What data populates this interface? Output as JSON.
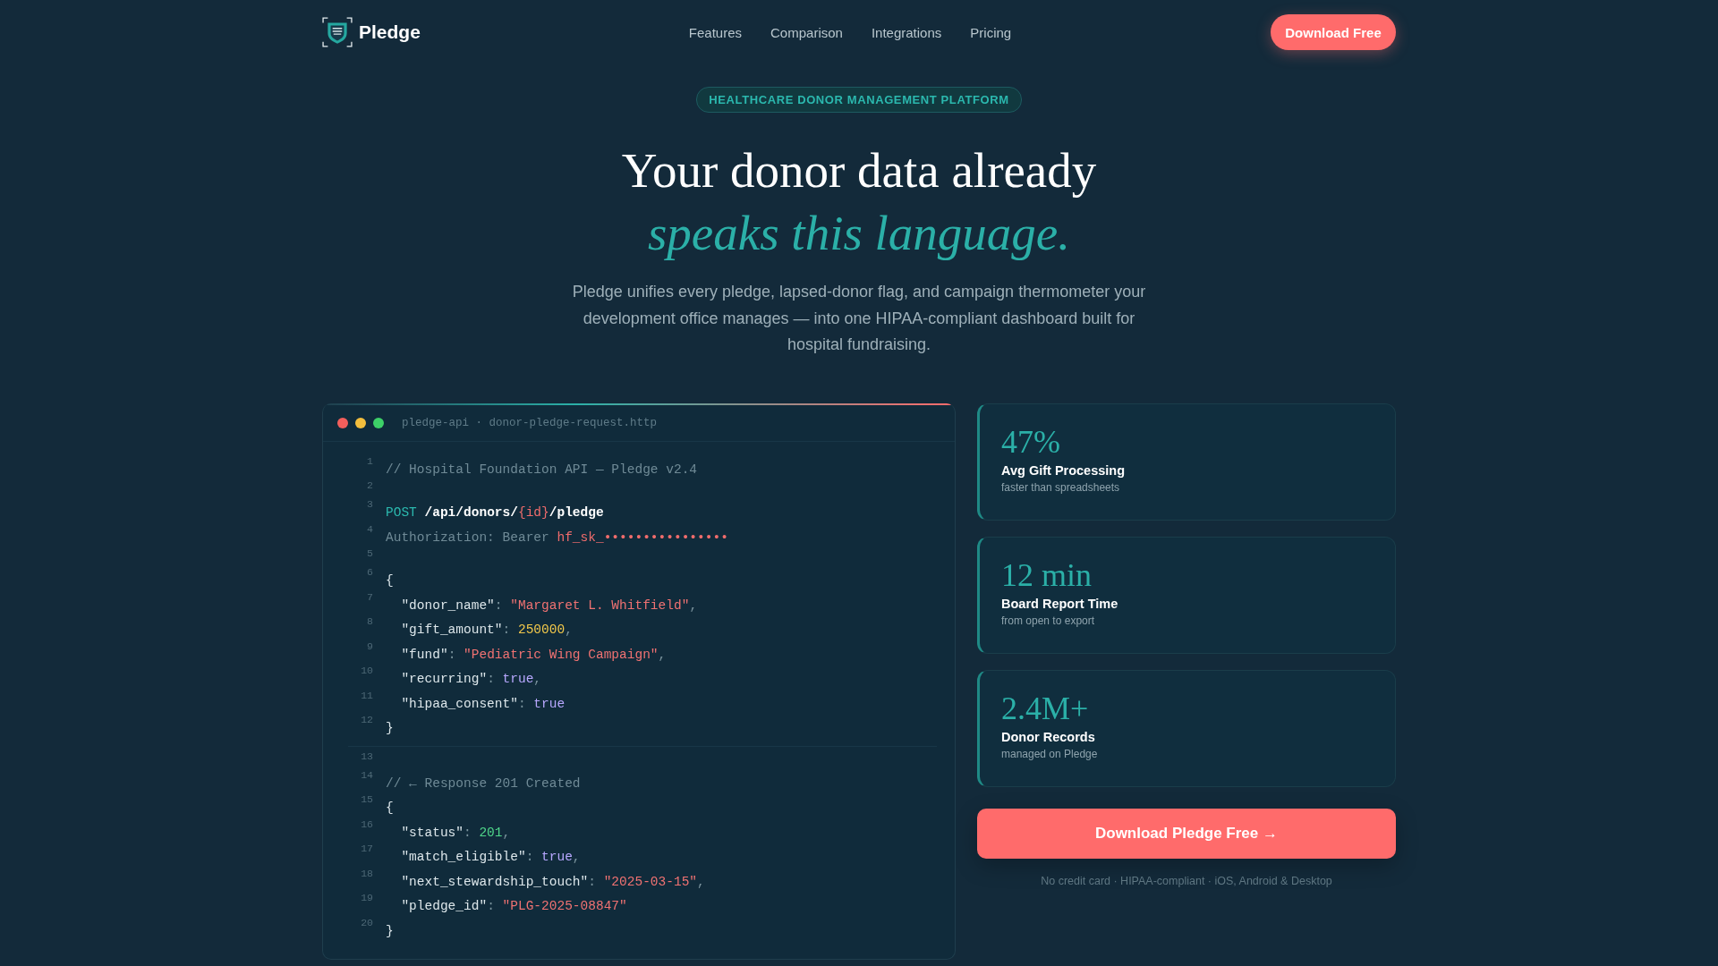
{
  "nav": {
    "brand": "Pledge",
    "links": [
      {
        "label": "Features"
      },
      {
        "label": "Comparison"
      },
      {
        "label": "Integrations"
      },
      {
        "label": "Pricing"
      }
    ],
    "cta": "Download Free"
  },
  "hero": {
    "badge": "HEALTHCARE DONOR MANAGEMENT PLATFORM",
    "title": "Your donor data already",
    "title_accent": "speaks this language.",
    "description": "Pledge unifies every pledge, lapsed-donor flag, and campaign thermometer your development office manages — into one HIPAA-compliant dashboard built for hospital fundraising."
  },
  "code_window": {
    "filename": "pledge-api · donor-pledge-request.http",
    "blocks": [
      {
        "lines": [
          {
            "number": "1",
            "tokens": [
              {
                "kind": "comment",
                "text": "// Hospital Foundation API — Pledge v2.4"
              }
            ]
          },
          {
            "number": "2"
          },
          {
            "number": "3",
            "tokens": [
              {
                "kind": "method",
                "text": "POST "
              },
              {
                "kind": "path",
                "text": "/api/donors/"
              },
              {
                "kind": "param",
                "text": "{id}"
              },
              {
                "kind": "path",
                "text": "/pledge"
              }
            ]
          },
          {
            "number": "4",
            "tokens": [
              {
                "kind": "comment",
                "text": "Authorization: Bearer "
              },
              {
                "kind": "secret",
                "text": "hf_sk_••••••••••••••••"
              }
            ]
          },
          {
            "number": "5"
          },
          {
            "number": "6",
            "tokens": [
              {
                "kind": "plain",
                "text": "{"
              }
            ]
          },
          {
            "number": "7",
            "tokens": [
              {
                "kind": "plain",
                "text": "  \"donor_name\""
              },
              {
                "kind": "punct",
                "text": ": "
              },
              {
                "kind": "string",
                "text": "\"Margaret L. Whitfield\""
              },
              {
                "kind": "punct",
                "text": ","
              }
            ]
          },
          {
            "number": "8",
            "tokens": [
              {
                "kind": "plain",
                "text": "  \"gift_amount\""
              },
              {
                "kind": "punct",
                "text": ": "
              },
              {
                "kind": "number",
                "text": "250000"
              },
              {
                "kind": "punct",
                "text": ","
              }
            ]
          },
          {
            "number": "9",
            "tokens": [
              {
                "kind": "plain",
                "text": "  \"fund\""
              },
              {
                "kind": "punct",
                "text": ": "
              },
              {
                "kind": "string",
                "text": "\"Pediatric Wing Campaign\""
              },
              {
                "kind": "punct",
                "text": ","
              }
            ]
          },
          {
            "number": "10",
            "tokens": [
              {
                "kind": "plain",
                "text": "  \"recurring\""
              },
              {
                "kind": "punct",
                "text": ": "
              },
              {
                "kind": "bool",
                "text": "true"
              },
              {
                "kind": "punct",
                "text": ","
              }
            ]
          },
          {
            "number": "11",
            "tokens": [
              {
                "kind": "plain",
                "text": "  \"hipaa_consent\""
              },
              {
                "kind": "punct",
                "text": ": "
              },
              {
                "kind": "bool",
                "text": "true"
              }
            ]
          },
          {
            "number": "12",
            "tokens": [
              {
                "kind": "plain",
                "text": "}"
              }
            ]
          }
        ]
      },
      {
        "lines": [
          {
            "number": "13"
          },
          {
            "number": "14",
            "tokens": [
              {
                "kind": "comment",
                "text": "// ← Response 201 Created"
              }
            ]
          },
          {
            "number": "15",
            "tokens": [
              {
                "kind": "plain",
                "text": "{"
              }
            ]
          },
          {
            "number": "16",
            "tokens": [
              {
                "kind": "plain",
                "text": "  \"status\""
              },
              {
                "kind": "punct",
                "text": ": "
              },
              {
                "kind": "status",
                "text": "201"
              },
              {
                "kind": "punct",
                "text": ","
              }
            ]
          },
          {
            "number": "17",
            "tokens": [
              {
                "kind": "plain",
                "text": "  \"match_eligible\""
              },
              {
                "kind": "punct",
                "text": ": "
              },
              {
                "kind": "bool",
                "text": "true"
              },
              {
                "kind": "punct",
                "text": ","
              }
            ]
          },
          {
            "number": "18",
            "tokens": [
              {
                "kind": "plain",
                "text": "  \"next_stewardship_touch\""
              },
              {
                "kind": "punct",
                "text": ": "
              },
              {
                "kind": "string",
                "text": "\"2025-03-15\""
              },
              {
                "kind": "punct",
                "text": ","
              }
            ]
          },
          {
            "number": "19",
            "tokens": [
              {
                "kind": "plain",
                "text": "  \"pledge_id\""
              },
              {
                "kind": "punct",
                "text": ": "
              },
              {
                "kind": "string",
                "text": "\"PLG-2025-08847\""
              }
            ]
          },
          {
            "number": "20",
            "tokens": [
              {
                "kind": "plain",
                "text": "}"
              }
            ]
          }
        ]
      }
    ]
  },
  "stats": [
    {
      "value": "47%",
      "label": "Avg Gift Processing",
      "caption": "faster than spreadsheets"
    },
    {
      "value": "12 min",
      "label": "Board Report Time",
      "caption": "from open to export"
    },
    {
      "value": "2.4M+",
      "label": "Donor Records",
      "caption": "managed on Pledge"
    }
  ],
  "cta": {
    "button": "Download Pledge Free →",
    "note": "No credit card · HIPAA-compliant · iOS, Android & Desktop"
  }
}
